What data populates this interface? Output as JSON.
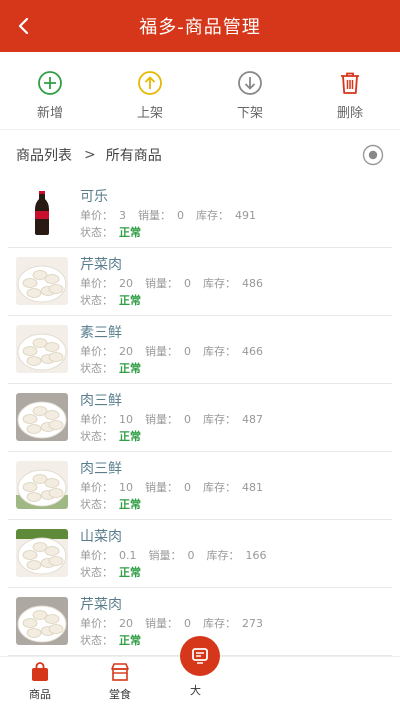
{
  "header": {
    "title": "福多-商品管理"
  },
  "toolbar": {
    "add_label": "新增",
    "shelve_label": "上架",
    "unshelve_label": "下架",
    "delete_label": "删除"
  },
  "breadcrumb": {
    "root": "商品列表",
    "separator": ">",
    "current": "所有商品"
  },
  "field_labels": {
    "price": "单价：",
    "sales": "销量：",
    "stock": "库存：",
    "status": "状态："
  },
  "products": [
    {
      "name": "可乐",
      "price": "3",
      "sales": "0",
      "stock": "491",
      "status": "正常",
      "thumb": "cola-bottle"
    },
    {
      "name": "芹菜肉",
      "price": "20",
      "sales": "0",
      "stock": "486",
      "status": "正常",
      "thumb": "dumplings-tray"
    },
    {
      "name": "素三鲜",
      "price": "20",
      "sales": "0",
      "stock": "466",
      "status": "正常",
      "thumb": "dumplings-plate"
    },
    {
      "name": "肉三鲜",
      "price": "10",
      "sales": "0",
      "stock": "487",
      "status": "正常",
      "thumb": "dumplings-sauce"
    },
    {
      "name": "肉三鲜",
      "price": "10",
      "sales": "0",
      "stock": "481",
      "status": "正常",
      "thumb": "dumplings-cabbage"
    },
    {
      "name": "山菜肉",
      "price": "0.1",
      "sales": "0",
      "stock": "166",
      "status": "正常",
      "thumb": "dumplings-green"
    },
    {
      "name": "芹菜肉",
      "price": "20",
      "sales": "0",
      "stock": "273",
      "status": "正常",
      "thumb": "dumplings-sauce"
    }
  ],
  "tabs": {
    "goods": "商品",
    "dine": "堂食",
    "center": "大"
  },
  "colors": {
    "brand": "#d6361a",
    "status_ok": "#2f9e44",
    "add": "#2f9e44",
    "shelve": "#e6b800",
    "unshelve": "#888888",
    "delete": "#d6361a"
  }
}
